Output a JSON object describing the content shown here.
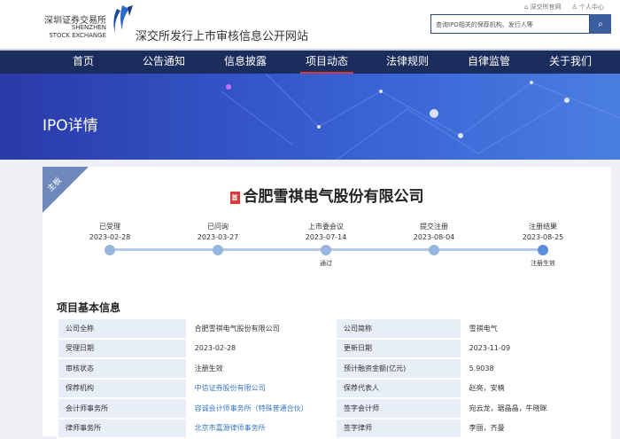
{
  "header": {
    "logo_cn": "深圳证券交易所",
    "logo_en_1": "SHENZHEN",
    "logo_en_2": "STOCK EXCHANGE",
    "site_title": "深交所发行上市审核信息公开网站",
    "links": [
      "深交所官网",
      "个人中心"
    ],
    "search_placeholder": "查询IPO相关的保荐机构、发行人等"
  },
  "nav": {
    "items": [
      "首页",
      "公告通知",
      "信息披露",
      "项目动态",
      "法律规则",
      "自律监管",
      "关于我们"
    ],
    "active": "项目动态"
  },
  "banner": {
    "title": "IPO详情"
  },
  "card": {
    "board": "主板",
    "badge": "首",
    "company": "合肥雪祺电气股份有限公司",
    "timeline": [
      {
        "label": "已受理",
        "date": "2023-02-28",
        "note": ""
      },
      {
        "label": "已问询",
        "date": "2023-03-27",
        "note": ""
      },
      {
        "label": "上市委会议",
        "date": "2023-07-14",
        "note": "通过"
      },
      {
        "label": "提交注册",
        "date": "2023-08-04",
        "note": ""
      },
      {
        "label": "注册结果",
        "date": "2023-08-25",
        "note": "注册生效"
      }
    ],
    "section_title": "项目基本信息",
    "rows": [
      [
        "公司全称",
        "合肥雪祺电气股份有限公司",
        "公司简称",
        "雪祺电气"
      ],
      [
        "受理日期",
        "2023-02-28",
        "更新日期",
        "2023-11-09"
      ],
      [
        "审核状态",
        "注册生效",
        "预计融资金额(亿元)",
        "5.9038"
      ],
      [
        "保荐机构",
        "中信证券股份有限公司",
        "保荐代表人",
        "赵亮，安楠"
      ],
      [
        "会计师事务所",
        "容诚会计师事务所（特殊普通合伙）",
        "签字会计师",
        "宛云龙，琚晶晶，牛晓眯"
      ],
      [
        "律师事务所",
        "北京市嘉源律师事务所",
        "签字律师",
        "李丽，齐曼"
      ]
    ]
  }
}
